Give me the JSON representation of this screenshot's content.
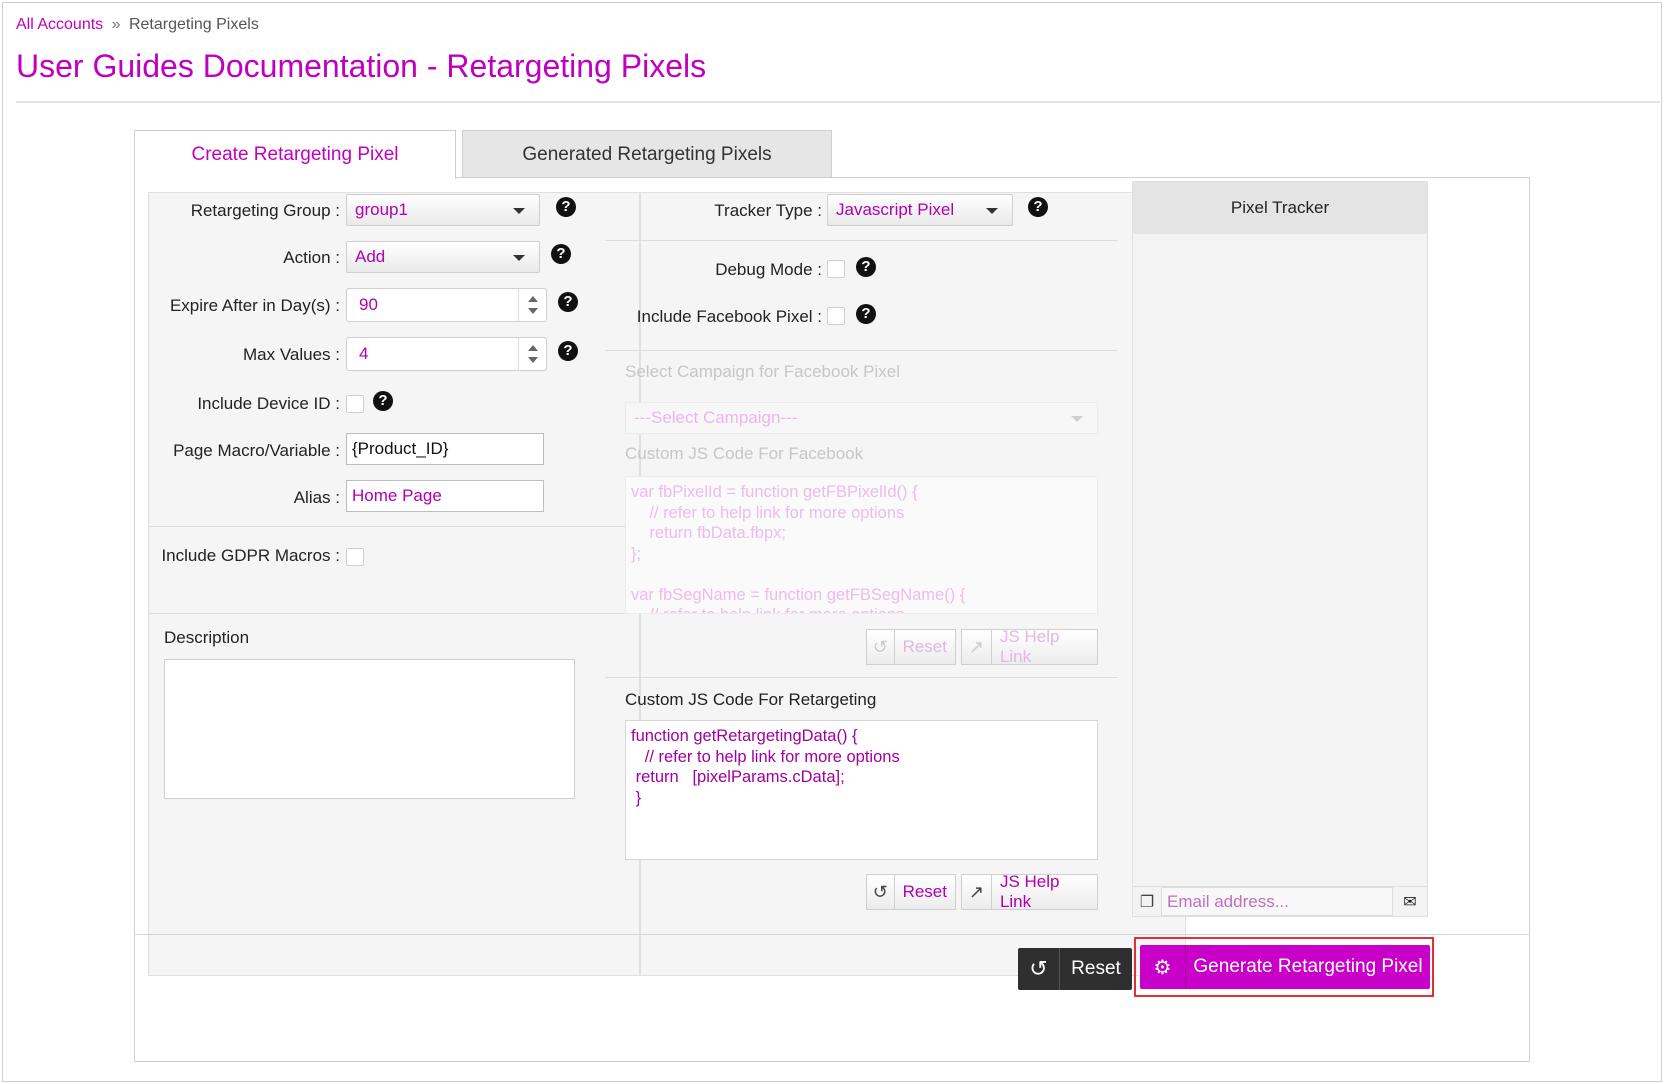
{
  "breadcrumb": {
    "root": "All Accounts",
    "separator": "»",
    "current": "Retargeting Pixels"
  },
  "page_title": "User Guides Documentation - Retargeting Pixels",
  "tabs": [
    {
      "label": "Create Retargeting Pixel",
      "active": true
    },
    {
      "label": "Generated Retargeting Pixels",
      "active": false
    }
  ],
  "form_left": {
    "retargeting_group": {
      "label": "Retargeting Group :",
      "value": "group1"
    },
    "action": {
      "label": "Action :",
      "value": "Add"
    },
    "expire": {
      "label": "Expire After in Day(s) :",
      "value": "90"
    },
    "max_values": {
      "label": "Max Values :",
      "value": "4"
    },
    "include_device_id": {
      "label": "Include Device ID :",
      "checked": false
    },
    "page_macro": {
      "label": "Page Macro/Variable :",
      "value": "{Product_ID}"
    },
    "alias": {
      "label": "Alias :",
      "value": "Home Page"
    },
    "include_gdpr": {
      "label": "Include GDPR Macros :",
      "checked": false
    },
    "description": {
      "label": "Description",
      "value": ""
    }
  },
  "form_mid": {
    "tracker_type": {
      "label": "Tracker Type :",
      "value": "Javascript Pixel"
    },
    "debug_mode": {
      "label": "Debug Mode :",
      "checked": false
    },
    "include_facebook": {
      "label": "Include Facebook Pixel :",
      "checked": false
    },
    "fb_campaign": {
      "label": "Select Campaign for Facebook Pixel",
      "placeholder": "---Select Campaign---"
    },
    "fb_code": {
      "label": "Custom JS Code For Facebook",
      "lines": [
        "var fbPixelId = function getFBPixelId() {",
        "    // refer to help link for more options",
        "    return fbData.fbpx;",
        "};",
        "",
        "var fbSegName = function getFBSegName() {",
        "    // refer to help link for more options"
      ]
    },
    "retargeting_code": {
      "label": "Custom JS Code For Retargeting",
      "lines": [
        "function getRetargetingData() {",
        "   // refer to help link for more options",
        " return   [pixelParams.cData];",
        " }"
      ]
    },
    "reset_label": "Reset",
    "help_link_label": "JS Help Link"
  },
  "tracker": {
    "title": "Pixel Tracker",
    "email_placeholder": "Email address..."
  },
  "footer": {
    "reset_label": "Reset",
    "generate_label": "Generate Retargeting Pixel"
  },
  "colors": {
    "accent": "#c800c8",
    "dark_button": "#2f2f2f",
    "highlight": "#e03030"
  }
}
